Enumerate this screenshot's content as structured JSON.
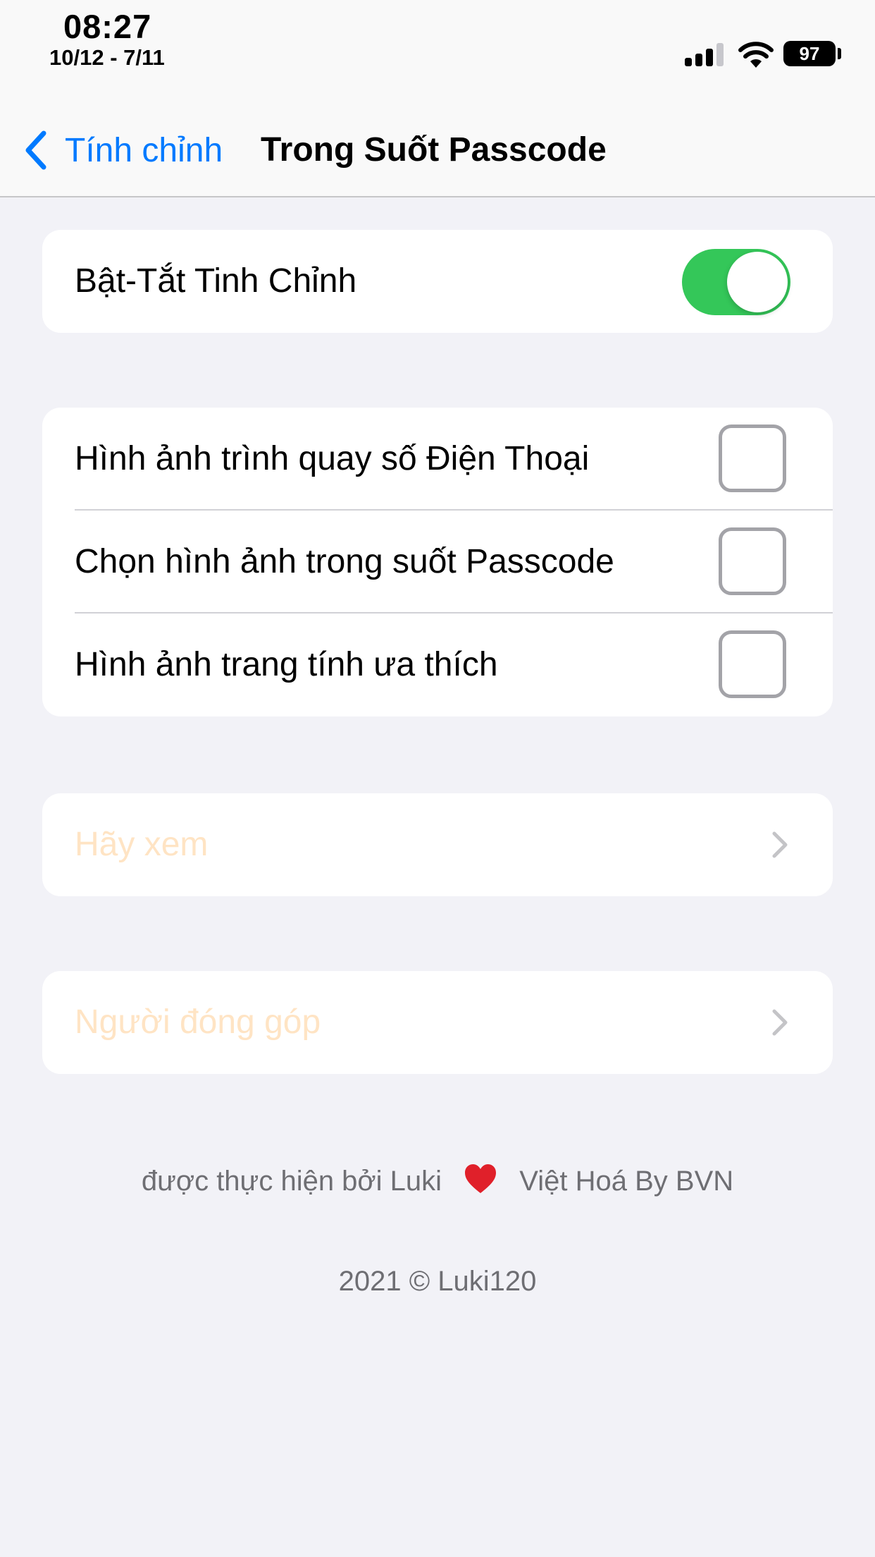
{
  "status_bar": {
    "time": "08:27",
    "date": "10/12 - 7/11",
    "battery": "97",
    "signal_icon": "cellular-signal-icon",
    "wifi_icon": "wifi-icon"
  },
  "nav": {
    "back_label": "Tính chỉnh",
    "title": "Trong Suốt Passcode",
    "back_icon": "chevron-left-icon"
  },
  "toggle_group": {
    "label": "Bật-Tắt Tinh Chỉnh",
    "enabled": true
  },
  "options": [
    {
      "label": "Hình ảnh trình quay số Điện Thoại",
      "checked": false
    },
    {
      "label": "Chọn hình ảnh trong suốt Passcode",
      "checked": false
    },
    {
      "label": "Hình ảnh trang tính ưa thích",
      "checked": false
    }
  ],
  "links": {
    "view": "Hãy xem",
    "contributors": "Người đóng góp"
  },
  "footer": {
    "credit_left": "được thực hiện bởi Luki",
    "credit_right": "Việt Hoá By BVN",
    "copyright": "2021 © Luki120"
  },
  "colors": {
    "accent": "#007aff",
    "toggle_on": "#34c759",
    "link_text": "#ffe4c4",
    "background": "#f2f2f7",
    "heart": "#e0202a"
  }
}
